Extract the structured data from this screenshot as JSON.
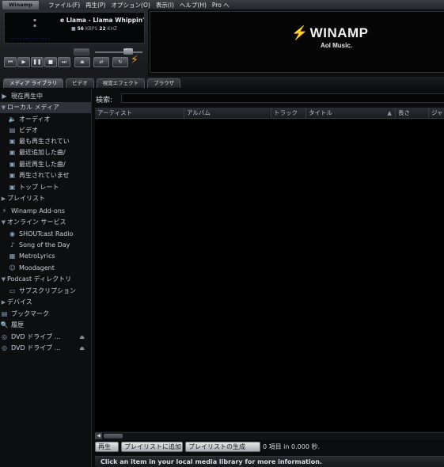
{
  "menubar": {
    "logo": "Winamp",
    "items": [
      "ファイル(F)",
      "再生(P)",
      "オプション(O)",
      "表示(I)",
      "ヘルプ(H)",
      "Pro へ"
    ]
  },
  "player": {
    "song_title": "e Llama - Llama Whippin' Int",
    "kbps": "56",
    "kbps_unit": "KBPS",
    "khz": "22",
    "khz_unit": "KHZ",
    "volume_level": 0.75
  },
  "banner": {
    "logo_text": "WINAMP",
    "subtitle": "Aol Music."
  },
  "tabs": [
    {
      "label": "メディア ライブラリ",
      "active": true
    },
    {
      "label": "ビデオ",
      "active": false
    },
    {
      "label": "視覚エフェクト",
      "active": false
    },
    {
      "label": "ブラウザ",
      "active": false
    }
  ],
  "sidebar": {
    "now_playing": "現在再生中",
    "local_media": "ローカル メディア",
    "audio": "オーディオ",
    "video": "ビデオ",
    "most_played": "最も再生されてい",
    "recently_added": "最近追加した曲/",
    "recently_played": "最近再生した曲/",
    "never_played": "再生されていませ",
    "top_rated": "トップ レート",
    "playlists": "プレイリスト",
    "addons": "Winamp Add-ons",
    "online_services": "オンライン サービス",
    "shoutcast": "SHOUTcast Radio",
    "song_of_day": "Song of the Day",
    "metrolyrics": "MetroLyrics",
    "moodagent": "Moodagent",
    "podcast": "Podcast ディレクトリ",
    "subscriptions": "サブスクリプション",
    "devices": "デバイス",
    "bookmarks": "ブックマーク",
    "history": "履歴",
    "dvd1": "DVD ドライブ ...",
    "dvd2": "DVD ドライブ ..."
  },
  "main": {
    "search_label": "検索:",
    "search_value": "",
    "columns": [
      "アーティスト",
      "アルバム",
      "トラック",
      "タイトル",
      "長さ",
      "ジャ"
    ],
    "buttons": {
      "play": "再生",
      "add_to_playlist": "プレイリストに追加",
      "generate_playlist": "プレイリストの生成"
    },
    "count_text": "0 項目  in 0.000 秒.",
    "status_text": "Click an item in your local media library for more information."
  },
  "colors": {
    "accent": "#e6a423",
    "background": "#0b0c0e"
  }
}
